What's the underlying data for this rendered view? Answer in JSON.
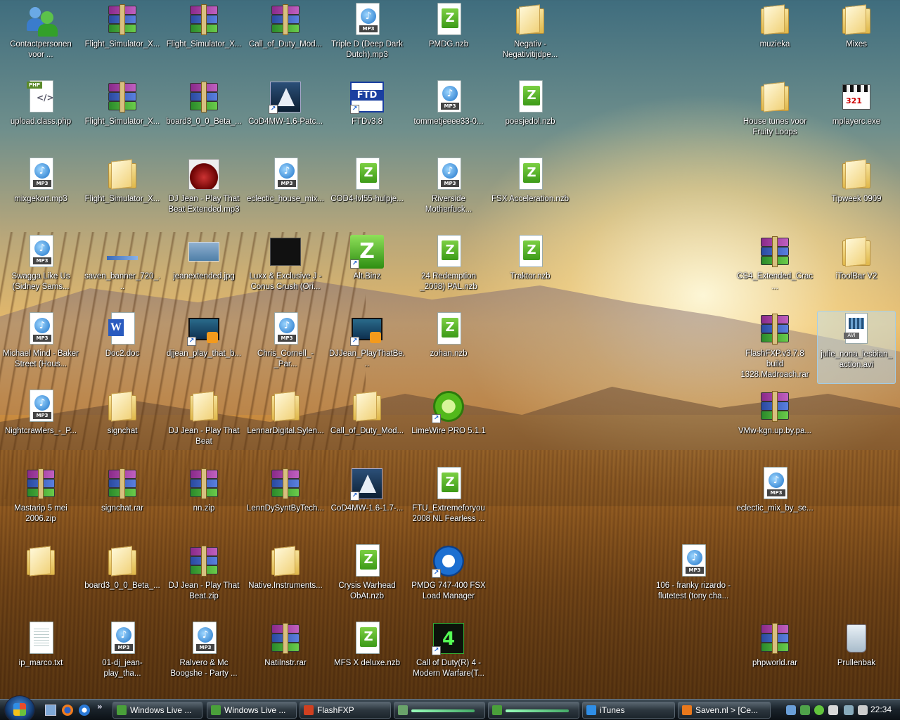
{
  "desktop": {
    "icons": [
      {
        "label": "Contactpersonen voor ...",
        "type": "contact"
      },
      {
        "label": "Flight_Simulator_X...",
        "type": "rar"
      },
      {
        "label": "Flight_Simulator_X...",
        "type": "rar"
      },
      {
        "label": "Call_of_Duty_Mod...",
        "type": "rar"
      },
      {
        "label": "Triple D (Deep Dark Dutch).mp3",
        "type": "mp3"
      },
      {
        "label": "PMDG.nzb",
        "type": "nzb"
      },
      {
        "label": "Negativ - Negativitijdpe...",
        "type": "folder"
      },
      {
        "label": "muzieka",
        "type": "folder"
      },
      {
        "label": "Mixes",
        "type": "folder"
      },
      {
        "label": "upload.class.php",
        "type": "php"
      },
      {
        "label": "Flight_Simulator_X...",
        "type": "rar"
      },
      {
        "label": "board3_0_0_Beta_...",
        "type": "rar"
      },
      {
        "label": "CoD4MW-1.6-Patc...",
        "type": "cod"
      },
      {
        "label": "FTDv3.8",
        "type": "ftd"
      },
      {
        "label": "tommetjeeee33-0...",
        "type": "mp3"
      },
      {
        "label": "poesjedol.nzb",
        "type": "nzb"
      },
      {
        "label": "House tunes voor Fruity Loops",
        "type": "folder"
      },
      {
        "label": "mplayerc.exe",
        "type": "exe"
      },
      {
        "label": "mixgekort.mp3",
        "type": "mp3"
      },
      {
        "label": "Flight_Simulator_X...",
        "type": "folder"
      },
      {
        "label": "DJ Jean - Play That Beat Extended.mp3",
        "type": "album"
      },
      {
        "label": "eclectic_house_mix...",
        "type": "mp3"
      },
      {
        "label": "COD4-lvl55-hulpje...",
        "type": "nzb"
      },
      {
        "label": "Riverside Motherfuck...",
        "type": "mp3"
      },
      {
        "label": "FSX Acceleration.nzb",
        "type": "nzb"
      },
      {
        "label": "Tipweek 0909",
        "type": "folder"
      },
      {
        "label": "Swagga Like Us (Sidney Sams...",
        "type": "mp3"
      },
      {
        "label": "saven_banner_720_...",
        "type": "banner"
      },
      {
        "label": "jeanextended.jpg",
        "type": "jpg"
      },
      {
        "label": "Luxx & Exclusive J - Conus Crush (Ori...",
        "type": "dark"
      },
      {
        "label": "Alt.Binz",
        "type": "altz"
      },
      {
        "label": "24 Redemption _2008) PAL.nzb",
        "type": "nzb"
      },
      {
        "label": "Traktor.nzb",
        "type": "nzb"
      },
      {
        "label": "CS4_Extended_Crac...",
        "type": "rar"
      },
      {
        "label": "iToolBar V2",
        "type": "folder"
      },
      {
        "label": "Michael Mind - Baker Street (Hous...",
        "type": "mp3"
      },
      {
        "label": "Doc2.doc",
        "type": "word"
      },
      {
        "label": "djjean_play_that_b...",
        "type": "video"
      },
      {
        "label": "Chris_Cornell_-_Par...",
        "type": "mp3"
      },
      {
        "label": "DJJean_PlayThatBe...",
        "type": "video"
      },
      {
        "label": "zohan.nzb",
        "type": "nzb"
      },
      {
        "label": "FlashFXP.v3.7.8 build 1328.Madroach.rar",
        "type": "rar"
      },
      {
        "label": "julie_nona_lesbian_action.avi",
        "type": "avi"
      },
      {
        "label": "Nightcrawlers_-_P...",
        "type": "mp3"
      },
      {
        "label": "signchat",
        "type": "folder"
      },
      {
        "label": "DJ Jean - Play That Beat",
        "type": "folder"
      },
      {
        "label": "LennarDigital.Sylen...",
        "type": "folder"
      },
      {
        "label": "Call_of_Duty_Mod...",
        "type": "folder"
      },
      {
        "label": "LimeWire PRO 5.1.1",
        "type": "lime"
      },
      {
        "label": "VMw-kgn.up.by.pa...",
        "type": "rar"
      },
      {
        "label": "Mastarip 5 mei 2006.zip",
        "type": "rar"
      },
      {
        "label": "signchat.rar",
        "type": "rar"
      },
      {
        "label": "nn.zip",
        "type": "rar"
      },
      {
        "label": "LennDySyntByTech...",
        "type": "rar"
      },
      {
        "label": "CoD4MW-1.6-1.7-...",
        "type": "cod"
      },
      {
        "label": "FTU_Extremeforyou 2008 NL Fearless ...",
        "type": "nzb"
      },
      {
        "label": "eclectic_mix_by_se...",
        "type": "mp3"
      },
      {
        "label": "",
        "type": "folder"
      },
      {
        "label": "board3_0_0_Beta_...",
        "type": "folder"
      },
      {
        "label": "DJ Jean - Play That Beat.zip",
        "type": "rar"
      },
      {
        "label": "Native.Instruments...",
        "type": "folder"
      },
      {
        "label": "Crysis Warhead ObAt.nzb",
        "type": "nzb"
      },
      {
        "label": "PMDG 747-400 FSX Load Manager",
        "type": "pmdg"
      },
      {
        "label": "106 - franky rizardo - flutetest (tony cha...",
        "type": "mp3"
      },
      {
        "label": "ip_marco.txt",
        "type": "txt"
      },
      {
        "label": "01-dj_jean-play_tha...",
        "type": "mp3"
      },
      {
        "label": "Ralvero & Mc Boogshe - Party ...",
        "type": "mp3"
      },
      {
        "label": "NatiInstr.rar",
        "type": "rar"
      },
      {
        "label": "MFS X deluxe.nzb",
        "type": "nzb"
      },
      {
        "label": "Call of Duty(R) 4 - Modern Warfare(T...",
        "type": "cod4"
      },
      {
        "label": "phpworld.rar",
        "type": "rar"
      },
      {
        "label": "Prullenbak",
        "type": "trash"
      }
    ]
  },
  "taskbar": {
    "buttons": [
      {
        "label": "Windows Live ...",
        "icon": "windows-live-icon"
      },
      {
        "label": "Windows Live ...",
        "icon": "windows-live-icon"
      },
      {
        "label": "FlashFXP",
        "icon": "flashfxp-icon"
      },
      {
        "label": "",
        "icon": "progress-window-icon"
      },
      {
        "label": "",
        "icon": "messenger-icon"
      },
      {
        "label": "iTunes",
        "icon": "itunes-icon"
      },
      {
        "label": "Saven.nl > [Ce...",
        "icon": "firefox-icon"
      }
    ],
    "quicklaunch_more": "»",
    "clock": "22:34"
  },
  "colors": {
    "taskbar": "#1a232b",
    "selection": "#bee1f5"
  }
}
